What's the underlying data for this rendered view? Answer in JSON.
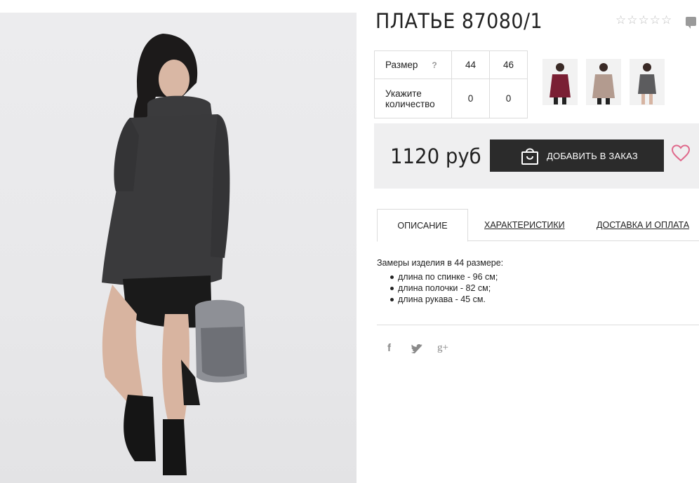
{
  "product": {
    "title": "ПЛАТЬЕ 87080/1",
    "rating_stars": [
      "☆",
      "☆",
      "☆",
      "☆",
      "☆"
    ]
  },
  "size_table": {
    "size_label": "Размер",
    "help_mark": "?",
    "quantity_label_line1": "Укажите",
    "quantity_label_line2": "количество",
    "sizes": [
      "44",
      "46"
    ],
    "quantities": [
      "0",
      "0"
    ]
  },
  "purchase": {
    "price": "1120 руб",
    "add_to_cart_label": "ДОБАВИТЬ В ЗАКАЗ"
  },
  "tabs": [
    {
      "label": "ОПИСАНИЕ",
      "active": true
    },
    {
      "label": "ХАРАКТЕРИСТИКИ",
      "active": false
    },
    {
      "label": "ДОСТАВКА И ОПЛАТА",
      "active": false
    }
  ],
  "description": {
    "intro": "Замеры изделия в 44 размере:",
    "items": [
      "длина по спинке - 96 см;",
      "длина полочки - 82 см;",
      "длина рукава - 45 см."
    ]
  },
  "social": {
    "facebook_glyph": "f",
    "twitter_glyph": "✔",
    "googleplus_glyph": "g+"
  },
  "colors": {
    "button_bg": "#2b2b2b",
    "price_box_bg": "#efeff0",
    "heart": "#e06a8c",
    "dress": "#3a3a3c"
  }
}
